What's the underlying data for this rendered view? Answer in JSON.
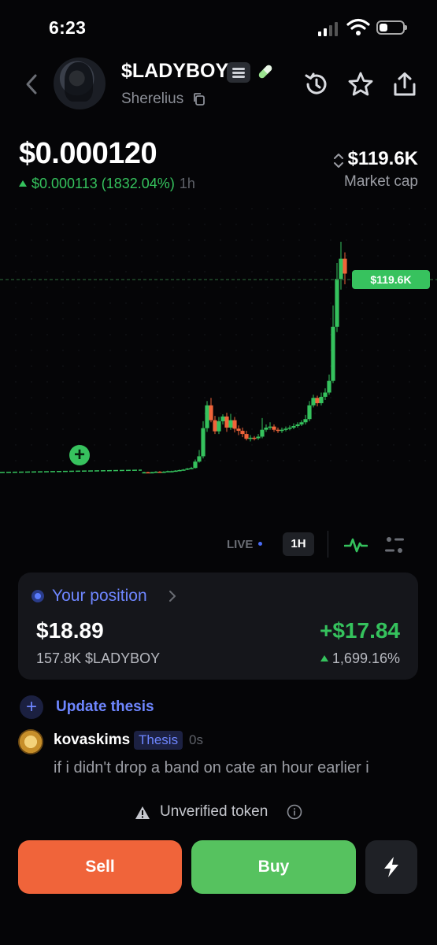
{
  "status_bar": {
    "time": "6:23"
  },
  "token": {
    "ticker": "$LADYBOY",
    "creator": "Sherelius",
    "price": "$0.000120",
    "change": "$0.000113 (1832.04%)",
    "period": "1h",
    "market_cap": "$119.6K",
    "market_cap_label": "Market cap"
  },
  "chart": {
    "marker_label": "$119.6K",
    "live_label": "LIVE",
    "timeframe": "1H"
  },
  "chart_data": {
    "type": "candlestick",
    "current_market_cap": "$119.6K",
    "candles": [
      {
        "o": 0.5,
        "c": 0.6,
        "h": 0.7,
        "l": 0.4
      },
      {
        "o": 0.6,
        "c": 0.5,
        "h": 0.7,
        "l": 0.4
      },
      {
        "o": 0.5,
        "c": 0.6,
        "h": 0.7,
        "l": 0.4
      },
      {
        "o": 0.6,
        "c": 0.7,
        "h": 0.8,
        "l": 0.5
      },
      {
        "o": 0.7,
        "c": 0.6,
        "h": 0.8,
        "l": 0.5
      },
      {
        "o": 0.6,
        "c": 0.7,
        "h": 0.8,
        "l": 0.5
      },
      {
        "o": 0.7,
        "c": 0.8,
        "h": 0.9,
        "l": 0.6
      },
      {
        "o": 0.8,
        "c": 0.8,
        "h": 0.9,
        "l": 0.7
      },
      {
        "o": 0.8,
        "c": 0.9,
        "h": 1.0,
        "l": 0.7
      },
      {
        "o": 0.9,
        "c": 1.0,
        "h": 1.1,
        "l": 0.8
      },
      {
        "o": 1.0,
        "c": 1.1,
        "h": 1.2,
        "l": 0.9
      },
      {
        "o": 1.1,
        "c": 1.3,
        "h": 1.4,
        "l": 1.0
      },
      {
        "o": 1.3,
        "c": 1.4,
        "h": 1.6,
        "l": 1.2
      },
      {
        "o": 1.4,
        "c": 2.6,
        "h": 3.0,
        "l": 1.3
      },
      {
        "o": 2.6,
        "c": 3.6,
        "h": 4.8,
        "l": 2.4
      },
      {
        "o": 3.6,
        "c": 8.9,
        "h": 10.2,
        "l": 3.2
      },
      {
        "o": 8.9,
        "c": 13.2,
        "h": 14.0,
        "l": 8.2
      },
      {
        "o": 13.2,
        "c": 10.4,
        "h": 14.6,
        "l": 10.0
      },
      {
        "o": 10.4,
        "c": 8.3,
        "h": 11.2,
        "l": 7.8
      },
      {
        "o": 8.3,
        "c": 10.2,
        "h": 11.0,
        "l": 7.8
      },
      {
        "o": 10.2,
        "c": 11.1,
        "h": 11.5,
        "l": 9.6
      },
      {
        "o": 11.1,
        "c": 9.0,
        "h": 11.8,
        "l": 8.2
      },
      {
        "o": 9.0,
        "c": 10.4,
        "h": 11.6,
        "l": 8.6
      },
      {
        "o": 10.4,
        "c": 8.8,
        "h": 11.0,
        "l": 8.1
      },
      {
        "o": 8.8,
        "c": 8.4,
        "h": 9.4,
        "l": 7.6
      },
      {
        "o": 8.4,
        "c": 7.8,
        "h": 9.0,
        "l": 7.2
      },
      {
        "o": 7.8,
        "c": 6.9,
        "h": 8.4,
        "l": 6.6
      },
      {
        "o": 6.9,
        "c": 7.1,
        "h": 7.6,
        "l": 6.4
      },
      {
        "o": 7.1,
        "c": 7.0,
        "h": 7.4,
        "l": 6.6
      },
      {
        "o": 7.0,
        "c": 7.3,
        "h": 7.8,
        "l": 6.7
      },
      {
        "o": 7.3,
        "c": 8.6,
        "h": 10.8,
        "l": 7.0
      },
      {
        "o": 8.6,
        "c": 9.0,
        "h": 9.6,
        "l": 8.2
      },
      {
        "o": 9.0,
        "c": 9.2,
        "h": 10.0,
        "l": 8.6
      },
      {
        "o": 9.2,
        "c": 8.6,
        "h": 9.6,
        "l": 8.2
      },
      {
        "o": 8.6,
        "c": 8.4,
        "h": 9.0,
        "l": 8.0
      },
      {
        "o": 8.4,
        "c": 8.6,
        "h": 9.0,
        "l": 8.0
      },
      {
        "o": 8.6,
        "c": 8.8,
        "h": 9.2,
        "l": 8.3
      },
      {
        "o": 8.8,
        "c": 9.0,
        "h": 9.4,
        "l": 8.5
      },
      {
        "o": 9.0,
        "c": 9.3,
        "h": 9.8,
        "l": 8.7
      },
      {
        "o": 9.3,
        "c": 9.6,
        "h": 10.0,
        "l": 9.0
      },
      {
        "o": 9.6,
        "c": 10.0,
        "h": 10.4,
        "l": 9.3
      },
      {
        "o": 10.0,
        "c": 10.6,
        "h": 11.4,
        "l": 9.6
      },
      {
        "o": 10.6,
        "c": 13.2,
        "h": 14.0,
        "l": 10.2
      },
      {
        "o": 13.2,
        "c": 14.6,
        "h": 15.2,
        "l": 12.8
      },
      {
        "o": 14.6,
        "c": 13.6,
        "h": 15.0,
        "l": 13.0
      },
      {
        "o": 13.6,
        "c": 14.8,
        "h": 15.6,
        "l": 13.2
      },
      {
        "o": 14.8,
        "c": 15.6,
        "h": 16.4,
        "l": 14.2
      },
      {
        "o": 15.6,
        "c": 17.8,
        "h": 19.0,
        "l": 15.2
      },
      {
        "o": 17.8,
        "c": 28.0,
        "h": 32.0,
        "l": 17.4
      },
      {
        "o": 28.0,
        "c": 37.0,
        "h": 40.0,
        "l": 27.0
      },
      {
        "o": 37.0,
        "c": 40.8,
        "h": 44.0,
        "l": 35.0
      },
      {
        "o": 40.8,
        "c": 38.0,
        "h": 42.0,
        "l": 36.0
      }
    ]
  },
  "position": {
    "title": "Your position",
    "value": "$18.89",
    "pnl": "+$17.84",
    "amount": "157.8K $LADYBOY",
    "pnl_pct": "1,699.16%"
  },
  "thesis": {
    "update_label": "Update thesis",
    "comment_user": "kovaskims",
    "comment_badge": "Thesis",
    "comment_time": "0s",
    "comment_text": "if i didn't drop a band on cate an hour earlier i"
  },
  "footer": {
    "warning": "Unverified token",
    "sell_label": "Sell",
    "buy_label": "Buy"
  },
  "colors": {
    "green": "#35c25d",
    "red": "#f0643a",
    "accent": "#6e86ff",
    "background": "#050507"
  },
  "icons": [
    "back-chevron-icon",
    "menu-lines-icon",
    "pill-icon",
    "copy-icon",
    "history-icon",
    "star-icon",
    "share-icon",
    "sort-icon",
    "pulse-icon",
    "settings-sliders-icon",
    "warning-icon",
    "info-icon",
    "bolt-icon"
  ]
}
